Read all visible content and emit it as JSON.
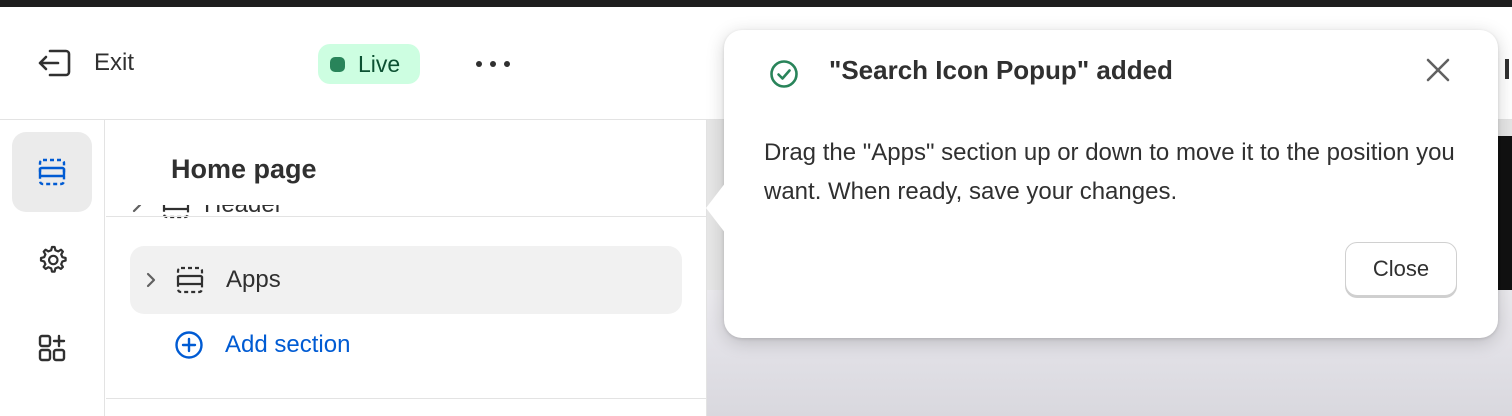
{
  "topbar": {
    "exit_label": "Exit",
    "status_label": "Live",
    "more_icon": "ellipsis-icon"
  },
  "rail": {
    "items": [
      {
        "icon": "sections-icon",
        "active": true
      },
      {
        "icon": "gear-icon",
        "active": false
      },
      {
        "icon": "apps-icon",
        "active": false
      }
    ]
  },
  "panel": {
    "title": "Home page",
    "sections": [
      {
        "label": "Header",
        "icon": "section-icon"
      },
      {
        "label": "Apps",
        "icon": "section-icon",
        "selected": true
      }
    ],
    "add_section_label": "Add section"
  },
  "popover": {
    "title": "\"Search Icon Popup\" added",
    "body": "Drag the \"Apps\" section up or down to move it to the position you want. When ready, save your changes.",
    "close_button_label": "Close"
  },
  "colors": {
    "live_badge_bg": "#cdfee1",
    "live_dot": "#29845a",
    "link_blue": "#005bd3",
    "success_green": "#29845a"
  }
}
